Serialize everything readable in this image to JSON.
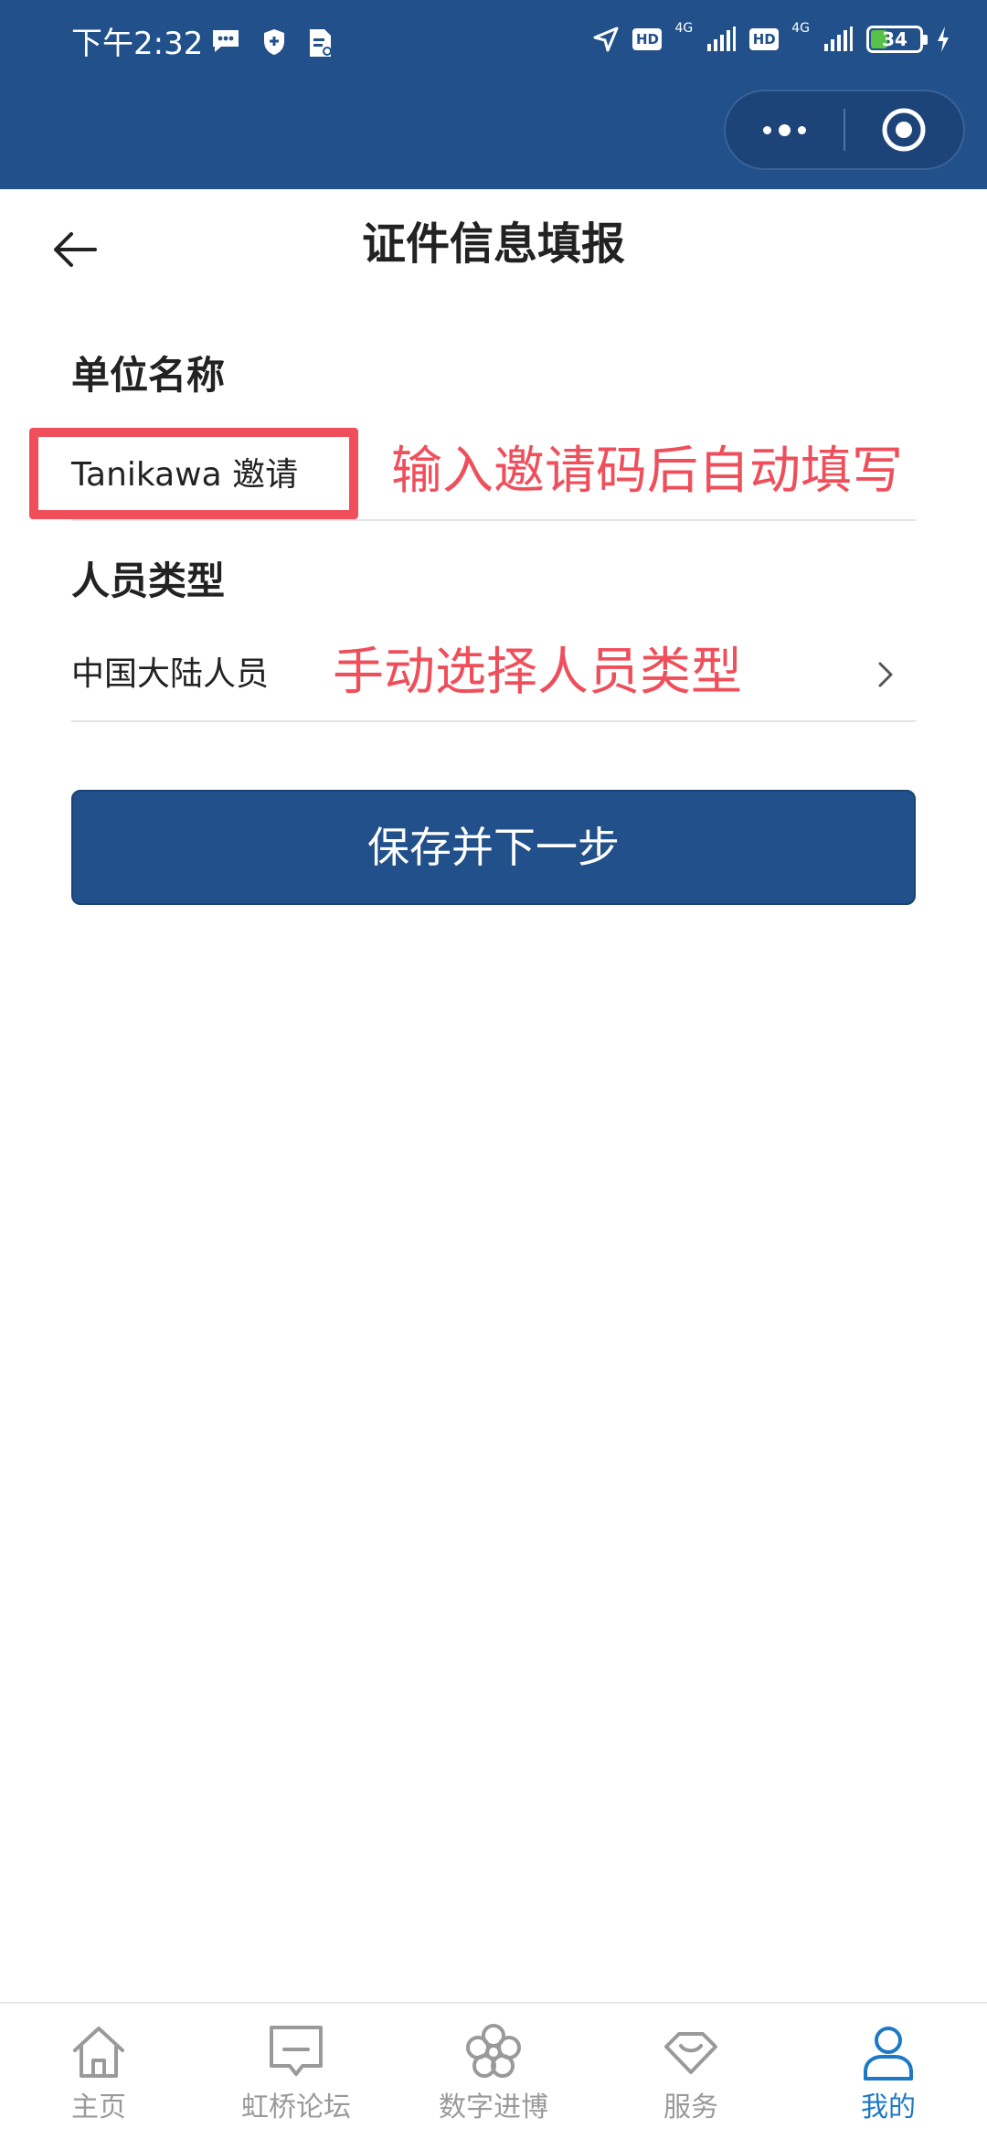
{
  "status_bar": {
    "time": "下午2:32",
    "network_1": "4G",
    "network_2": "4G",
    "hd_label": "HD",
    "battery_level": "34"
  },
  "header": {
    "title": "证件信息填报"
  },
  "form": {
    "org_label": "单位名称",
    "org_value": "Tanikawa 邀请",
    "org_annotation": "输入邀请码后自动填写",
    "type_label": "人员类型",
    "type_value": "中国大陆人员",
    "type_annotation": "手动选择人员类型",
    "save_button": "保存并下一步"
  },
  "tabbar": {
    "items": [
      {
        "label": "主页",
        "icon": "home-icon"
      },
      {
        "label": "虹桥论坛",
        "icon": "forum-icon"
      },
      {
        "label": "数字进博",
        "icon": "flower-icon"
      },
      {
        "label": "服务",
        "icon": "service-icon"
      },
      {
        "label": "我的",
        "icon": "user-icon",
        "active": true
      }
    ]
  },
  "colors": {
    "brand_blue": "#21508a",
    "annotation_red": "#ee4f5b",
    "tab_active": "#1d79c7"
  }
}
